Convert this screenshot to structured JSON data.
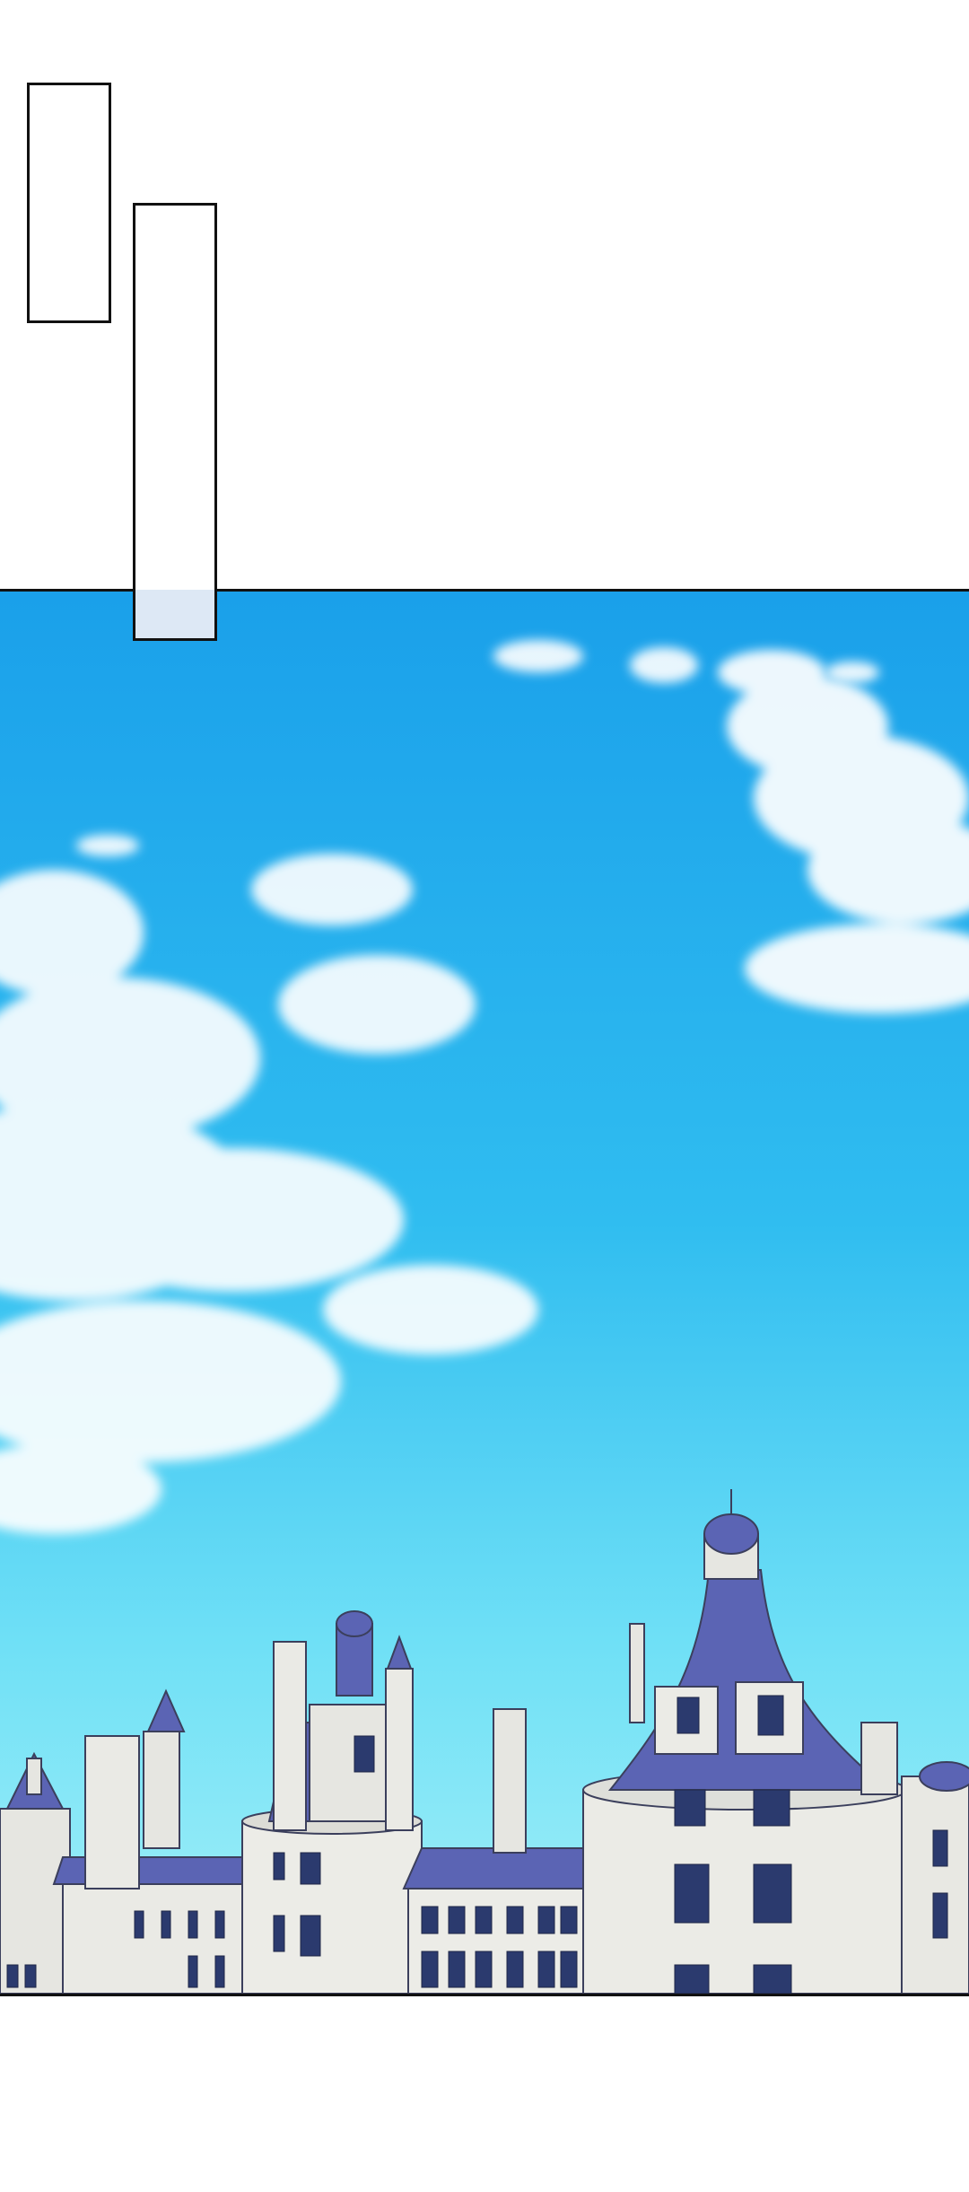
{
  "page": {
    "background": "#ffffff",
    "border_color": "#111111"
  },
  "caption_boxes": [
    {
      "text": ""
    },
    {
      "text": ""
    }
  ],
  "panel": {
    "sky_colors": [
      "#1aa3ea",
      "#3cc4f2",
      "#8eebf7"
    ],
    "roof_color": "#5b64b4",
    "stone_color": "#e9e9e4"
  }
}
